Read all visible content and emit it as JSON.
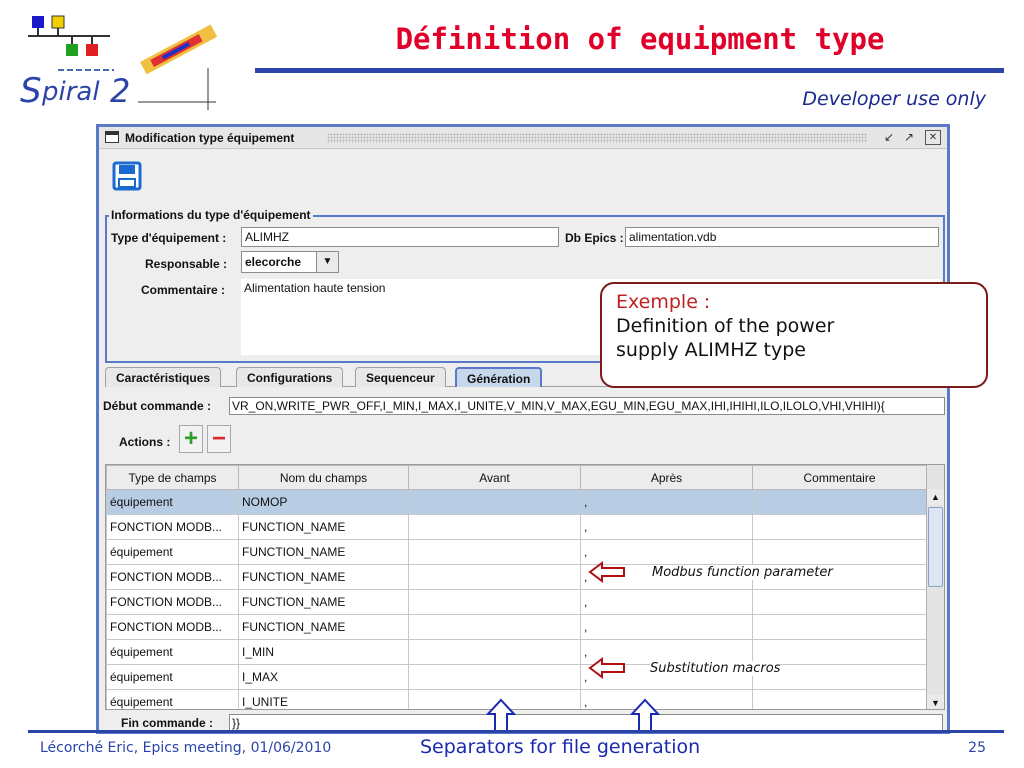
{
  "slide": {
    "title": "Définition of equipment type",
    "developer_note": "Developer use only",
    "footer_author": "Lécorché Eric, Epics meeting, 01/06/2010",
    "footer_separators": "Separators for file generation",
    "page_number": "25",
    "logo_text": "Spiral2"
  },
  "window": {
    "title": "Modification type équipement",
    "controls": {
      "minimize": "↙",
      "maximize": "↗",
      "close": "✕"
    }
  },
  "info": {
    "legend": "Informations du type d'équipement",
    "type_label": "Type d'équipement :",
    "type_value": "ALIMHZ",
    "db_label": "Db Epics :",
    "db_value": "alimentation.vdb",
    "resp_label": "Responsable :",
    "resp_value": "elecorche",
    "comment_label": "Commentaire :",
    "comment_value": "Alimentation haute tension"
  },
  "tabs": [
    {
      "label": "Caractéristiques",
      "active": false
    },
    {
      "label": "Configurations",
      "active": false
    },
    {
      "label": "Sequenceur",
      "active": false
    },
    {
      "label": "Génération",
      "active": true
    }
  ],
  "generation": {
    "start_label": "Début commande :",
    "start_value": "VR_ON,WRITE_PWR_OFF,I_MIN,I_MAX,I_UNITE,V_MIN,V_MAX,EGU_MIN,EGU_MAX,IHI,IHIHI,ILO,ILOLO,VHI,VHIHI){",
    "actions_label": "Actions :",
    "add_symbol": "+",
    "remove_symbol": "−",
    "end_label": "Fin commande :",
    "end_value": "}}"
  },
  "table": {
    "columns": [
      "Type de champs",
      "Nom du champs",
      "Avant",
      "Après",
      "Commentaire"
    ],
    "rows": [
      {
        "type": "équipement",
        "name": "NOMOP",
        "avant": "",
        "apres": ",",
        "comment": "",
        "selected": true
      },
      {
        "type": "FONCTION MODB...",
        "name": "FUNCTION_NAME",
        "avant": "",
        "apres": ",",
        "comment": "",
        "selected": false
      },
      {
        "type": "équipement",
        "name": "FUNCTION_NAME",
        "avant": "",
        "apres": ",",
        "comment": "",
        "selected": false
      },
      {
        "type": "FONCTION MODB...",
        "name": "FUNCTION_NAME",
        "avant": "",
        "apres": ",",
        "comment": "",
        "selected": false
      },
      {
        "type": "FONCTION MODB...",
        "name": "FUNCTION_NAME",
        "avant": "",
        "apres": ",",
        "comment": "",
        "selected": false
      },
      {
        "type": "FONCTION MODB...",
        "name": "FUNCTION_NAME",
        "avant": "",
        "apres": ",",
        "comment": "",
        "selected": false
      },
      {
        "type": "équipement",
        "name": "I_MIN",
        "avant": "",
        "apres": ",",
        "comment": "",
        "selected": false
      },
      {
        "type": "équipement",
        "name": "I_MAX",
        "avant": "",
        "apres": ",",
        "comment": "",
        "selected": false
      },
      {
        "type": "équipement",
        "name": "I_UNITE",
        "avant": "",
        "apres": ",",
        "comment": "",
        "selected": false
      }
    ]
  },
  "callout": {
    "title": "Exemple :",
    "line1": "Definition of the power",
    "line2": "supply ALIMHZ type"
  },
  "annotations": {
    "modbus": "Modbus function parameter",
    "macros": "Substitution macros"
  },
  "colors": {
    "title_red": "#e0002a",
    "rule_blue": "#2a44a8",
    "window_border": "#5a7ac8",
    "arrow_red": "#b01010",
    "arrow_blue": "#1a2ab0"
  }
}
